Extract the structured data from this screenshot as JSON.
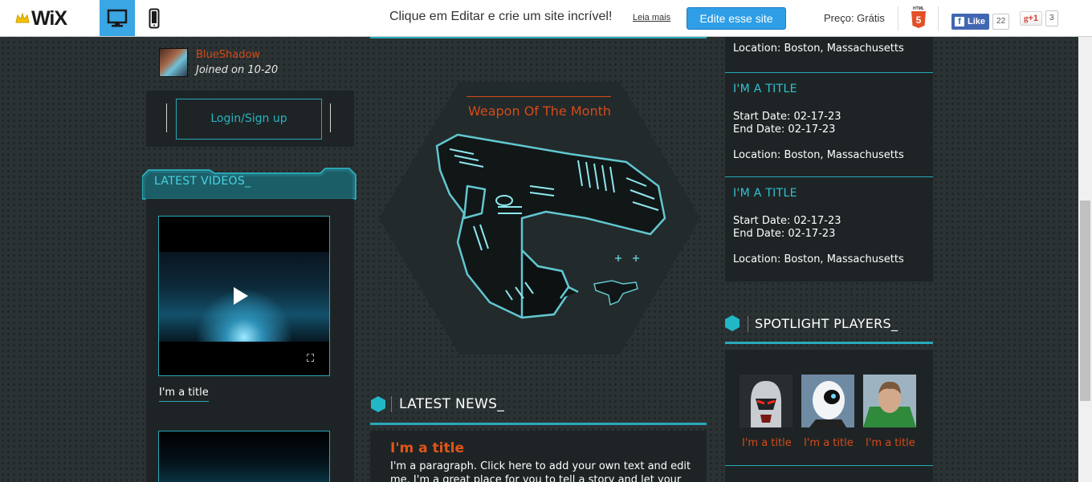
{
  "topbar": {
    "logo": "WiX",
    "promo": "Clique em Editar e crie um site incrível!",
    "read_more": "Leia mais",
    "edit_button": "Edite esse site",
    "price": "Preço: Grátis",
    "html5_badge": "HTML 5",
    "fb_like": "Like",
    "fb_count": "22",
    "gplus": "+1",
    "gplus_count": "3"
  },
  "user": {
    "name": "BlueShadow",
    "joined": "Joined on 10-20"
  },
  "login": {
    "label": "Login/Sign up"
  },
  "videos": {
    "title": "LATEST VIDEOS_",
    "items": [
      {
        "title": "I'm a title"
      }
    ]
  },
  "weapon": {
    "title": "Weapon Of The Month"
  },
  "news": {
    "title": "LATEST NEWS_",
    "item_title": "I'm a title",
    "item_text": "I'm a paragraph. Click here to add your own text and edit me. I'm a great place for you to tell a story and let your users"
  },
  "events": {
    "top_location": "Location: Boston, Massachusetts",
    "items": [
      {
        "title": "I'M A TITLE",
        "start": "Start Date: 02-17-23",
        "end": "End Date: 02-17-23",
        "location": "Location: Boston, Massachusetts"
      },
      {
        "title": "I'M A TITLE",
        "start": "Start Date: 02-17-23",
        "end": "End Date: 02-17-23",
        "location": "Location: Boston, Massachusetts"
      }
    ]
  },
  "spotlight": {
    "title": "SPOTLIGHT PLAYERS_",
    "players": [
      {
        "name": "I'm a title"
      },
      {
        "name": "I'm a title"
      },
      {
        "name": "I'm a title"
      }
    ]
  },
  "colors": {
    "accent": "#27a9b9",
    "orange": "#d54a1a",
    "panel": "#1e2425",
    "background": "#2b3233",
    "wix_blue": "#2f9ee6"
  }
}
